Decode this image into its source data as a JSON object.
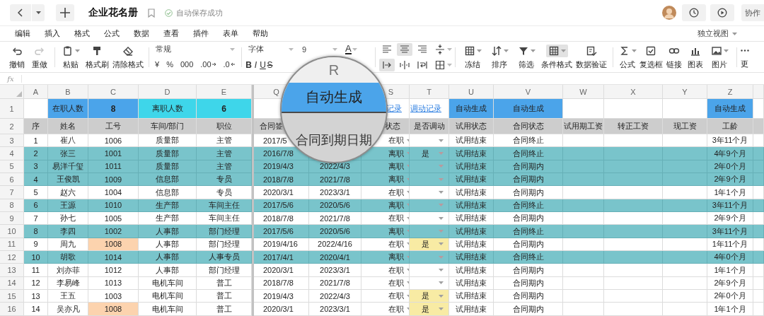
{
  "titlebar": {
    "title": "企业花名册",
    "save_status": "自动保存成功",
    "collaborate": "协作"
  },
  "menu": {
    "items": [
      "编辑",
      "插入",
      "格式",
      "公式",
      "数据",
      "查看",
      "插件",
      "表单",
      "帮助"
    ],
    "view_switch": "独立视图"
  },
  "toolbar": {
    "history": [
      {
        "label": "撤销",
        "disabled": false
      },
      {
        "label": "重做",
        "disabled": true
      }
    ],
    "clipboard": [
      "粘贴",
      "格式刷",
      "清除格式"
    ],
    "number_format": "常规",
    "number_symbols": [
      "¥",
      "%",
      "000",
      ".00",
      ".0"
    ],
    "font": {
      "family": "字体",
      "size": "9",
      "color_letter": "A"
    },
    "style_letters": [
      "B",
      "I",
      "U",
      "S"
    ],
    "align_buttons": [
      {
        "selected": false
      },
      {
        "selected": true
      },
      {
        "selected": false
      },
      {
        "selected": false
      }
    ],
    "indent_buttons": [
      {
        "selected": true
      },
      {
        "selected": false
      },
      {
        "selected": false
      },
      {
        "selected": false
      }
    ],
    "data_tools": [
      {
        "label": "冻结",
        "selected": false
      },
      {
        "label": "排序",
        "selected": false
      },
      {
        "label": "筛选",
        "selected": false
      },
      {
        "label": "条件格式",
        "selected": true
      },
      {
        "label": "数据验证",
        "selected": false
      }
    ],
    "insert_tools": [
      "公式",
      "复选框",
      "链接",
      "图表",
      "图片"
    ],
    "more": "更"
  },
  "formula_bar": {
    "label": "fx"
  },
  "column_letters": {
    "no": "A",
    "name": "B",
    "id": "C",
    "dept": "D",
    "position": "E",
    "sign_date": "Q",
    "status": "S",
    "transfer": "T",
    "probation": "U",
    "contract": "V",
    "probation_pay": "W",
    "regular_pay": "X",
    "current_pay": "Y",
    "seniority": "Z"
  },
  "summary_row": {
    "row_label": "1",
    "cells": {
      "name": {
        "text": "在职人数",
        "kind": "fill",
        "color": "#4ba4ea"
      },
      "id": {
        "text": "8",
        "kind": "fill",
        "color": "#4ba4ea"
      },
      "dept": {
        "text": "离职人数",
        "kind": "fill",
        "color": "#3ed6ea"
      },
      "position": {
        "text": "6",
        "kind": "fill",
        "color": "#3ed6ea"
      },
      "status": {
        "text": "记录",
        "kind": "link"
      },
      "transfer": {
        "text": "调动记录",
        "kind": "link"
      },
      "probation": {
        "text": "自动生成",
        "kind": "fill",
        "color": "#4ba4ea"
      },
      "contract": {
        "text": "自动生成",
        "kind": "fill",
        "color": "#4ba4ea"
      },
      "seniority": {
        "text": "自动生成",
        "kind": "fill",
        "color": "#4ba4ea"
      }
    }
  },
  "header_row": {
    "row_label": "2",
    "cells": {
      "no": "序",
      "name": "姓名",
      "id": "工号",
      "dept": "车间/部门",
      "position": "职位",
      "sign_date": "合同签",
      "status": "状态",
      "transfer": "是否调动",
      "probation": "试用状态",
      "contract": "合同状态",
      "probation_pay": "试用期工资",
      "regular_pay": "转正工资",
      "current_pay": "现工资",
      "seniority": "工龄"
    }
  },
  "rows": [
    {
      "row_label": "3",
      "highlighted": false,
      "duplicate_id": false,
      "transfer_marked": false,
      "cells": {
        "no": "1",
        "name": "崔八",
        "id": "1006",
        "dept": "质量部",
        "position": "主管",
        "sign_date": "2017/5",
        "status": "在职",
        "probation": "试用结束",
        "contract": "合同终止",
        "seniority": "3年11个月"
      }
    },
    {
      "row_label": "4",
      "highlighted": true,
      "duplicate_id": false,
      "transfer_marked": false,
      "cells": {
        "no": "2",
        "name": "张三",
        "id": "1001",
        "dept": "质量部",
        "position": "主管",
        "sign_date": "2016/7/8",
        "status": "离职",
        "transfer": "是",
        "probation": "试用结束",
        "contract": "合同终止",
        "seniority": "4年9个月"
      }
    },
    {
      "row_label": "5",
      "highlighted": true,
      "duplicate_id": false,
      "transfer_marked": false,
      "cells": {
        "no": "3",
        "name": "易洋千玺",
        "id": "1011",
        "dept": "质量部",
        "position": "主管",
        "sign_date": "2019/4/3",
        "end_date": "2022/4/3",
        "status": "离职",
        "probation": "试用结束",
        "contract": "合同期内",
        "seniority": "2年0个月"
      }
    },
    {
      "row_label": "6",
      "highlighted": true,
      "duplicate_id": false,
      "transfer_marked": false,
      "cells": {
        "no": "4",
        "name": "王俊凯",
        "id": "1009",
        "dept": "信息部",
        "position": "专员",
        "sign_date": "2018/7/8",
        "end_date": "2021/7/8",
        "status": "离职",
        "probation": "试用结束",
        "contract": "合同期内",
        "seniority": "2年9个月"
      }
    },
    {
      "row_label": "7",
      "highlighted": false,
      "duplicate_id": false,
      "transfer_marked": false,
      "cells": {
        "no": "5",
        "name": "赵六",
        "id": "1004",
        "dept": "信息部",
        "position": "专员",
        "sign_date": "2020/3/1",
        "end_date": "2023/3/1",
        "status": "在职",
        "probation": "试用结束",
        "contract": "合同期内",
        "seniority": "1年1个月"
      }
    },
    {
      "row_label": "8",
      "highlighted": true,
      "duplicate_id": false,
      "transfer_marked": false,
      "cells": {
        "no": "6",
        "name": "王源",
        "id": "1010",
        "dept": "生产部",
        "position": "车间主任",
        "sign_date": "2017/5/6",
        "end_date": "2020/5/6",
        "status": "离职",
        "probation": "试用结束",
        "contract": "合同终止",
        "seniority": "3年11个月"
      }
    },
    {
      "row_label": "9",
      "highlighted": false,
      "duplicate_id": false,
      "transfer_marked": false,
      "cells": {
        "no": "7",
        "name": "孙七",
        "id": "1005",
        "dept": "生产部",
        "position": "车间主任",
        "sign_date": "2018/7/8",
        "end_date": "2021/7/8",
        "status": "在职",
        "probation": "试用结束",
        "contract": "合同期内",
        "seniority": "2年9个月"
      }
    },
    {
      "row_label": "10",
      "highlighted": true,
      "duplicate_id": false,
      "transfer_marked": false,
      "cells": {
        "no": "8",
        "name": "李四",
        "id": "1002",
        "dept": "人事部",
        "position": "部门经理",
        "sign_date": "2017/5/6",
        "end_date": "2020/5/6",
        "status": "离职",
        "probation": "试用结束",
        "contract": "合同终止",
        "seniority": "3年11个月"
      }
    },
    {
      "row_label": "11",
      "highlighted": false,
      "duplicate_id": true,
      "transfer_marked": true,
      "cells": {
        "no": "9",
        "name": "周九",
        "id": "1008",
        "dept": "人事部",
        "position": "部门经理",
        "sign_date": "2019/4/16",
        "end_date": "2022/4/16",
        "status": "在职",
        "transfer": "是",
        "probation": "试用结束",
        "contract": "合同期内",
        "seniority": "1年11个月"
      }
    },
    {
      "row_label": "12",
      "highlighted": true,
      "duplicate_id": false,
      "transfer_marked": false,
      "cells": {
        "no": "10",
        "name": "胡歌",
        "id": "1014",
        "dept": "人事部",
        "position": "人事专员",
        "sign_date": "2017/4/1",
        "end_date": "2020/4/1",
        "status": "离职",
        "probation": "试用结束",
        "contract": "合同终止",
        "seniority": "4年0个月"
      }
    },
    {
      "row_label": "13",
      "highlighted": false,
      "duplicate_id": false,
      "transfer_marked": false,
      "cells": {
        "no": "11",
        "name": "刘亦菲",
        "id": "1012",
        "dept": "人事部",
        "position": "部门经理",
        "sign_date": "2020/3/1",
        "end_date": "2023/3/1",
        "status": "在职",
        "probation": "试用结束",
        "contract": "合同期内",
        "seniority": "1年1个月"
      }
    },
    {
      "row_label": "14",
      "highlighted": false,
      "duplicate_id": false,
      "transfer_marked": false,
      "cells": {
        "no": "12",
        "name": "李易峰",
        "id": "1013",
        "dept": "电机车间",
        "position": "普工",
        "sign_date": "2018/7/8",
        "end_date": "2021/7/8",
        "status": "在职",
        "probation": "试用结束",
        "contract": "合同期内",
        "seniority": "2年9个月"
      }
    },
    {
      "row_label": "15",
      "highlighted": false,
      "duplicate_id": false,
      "transfer_marked": true,
      "cells": {
        "no": "13",
        "name": "王五",
        "id": "1003",
        "dept": "电机车间",
        "position": "普工",
        "sign_date": "2019/4/3",
        "end_date": "2022/4/3",
        "status": "在职",
        "transfer": "是",
        "probation": "试用结束",
        "contract": "合同期内",
        "seniority": "2年0个月"
      }
    },
    {
      "row_label": "16",
      "highlighted": false,
      "duplicate_id": true,
      "transfer_marked": true,
      "cells": {
        "no": "14",
        "name": "吴亦凡",
        "id": "1008",
        "dept": "电机车间",
        "position": "普工",
        "sign_date": "2020/3/1",
        "end_date": "2023/3/1",
        "status": "在职",
        "transfer": "是",
        "probation": "试用结束",
        "contract": "合同期内",
        "seniority": "1年1个月"
      }
    }
  ],
  "magnifier": {
    "column_letter": "R",
    "summary": {
      "text": "自动生成",
      "color": "#4ba4ea"
    },
    "header": "合同到期日期"
  }
}
